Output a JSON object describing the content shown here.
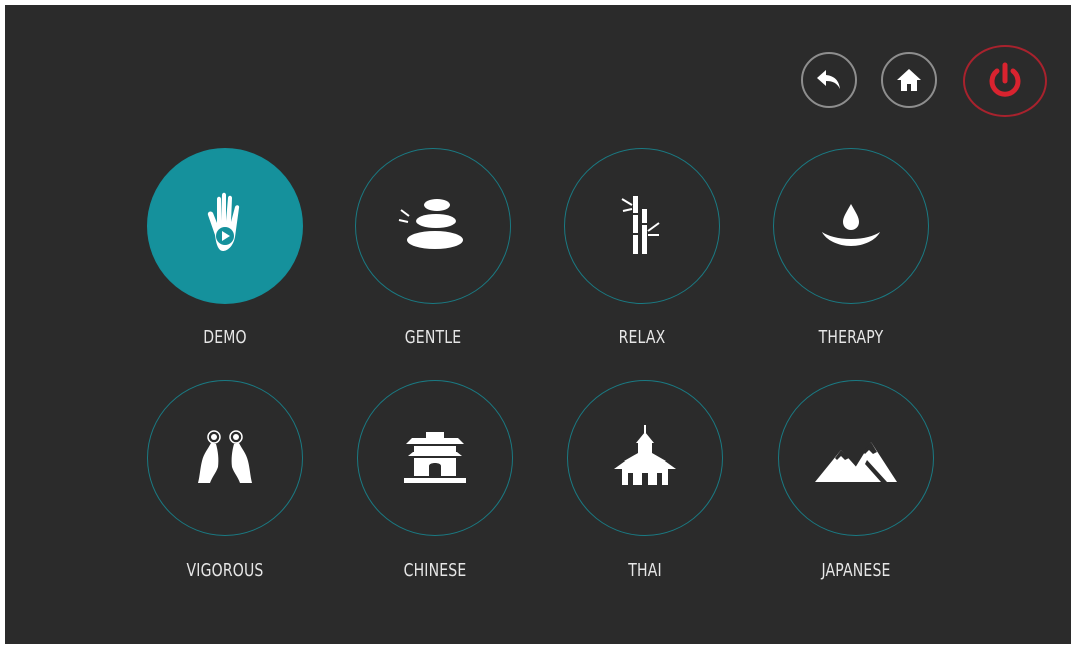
{
  "header": {
    "buttons": [
      {
        "name": "back",
        "icon": "back-arrow-icon"
      },
      {
        "name": "home",
        "icon": "home-icon"
      },
      {
        "name": "power",
        "icon": "power-icon",
        "color": "#d9232f"
      }
    ]
  },
  "colors": {
    "background": "#2b2b2b",
    "accent": "#15919c",
    "ring": "#1a7a83",
    "power": "#d9232f",
    "text": "#e6e6e6"
  },
  "modes": {
    "demo": {
      "label": "DEMO",
      "icon": "hand-play-icon",
      "active": true
    },
    "gentle": {
      "label": "GENTLE",
      "icon": "stacked-stones-icon"
    },
    "relax": {
      "label": "RELAX",
      "icon": "bamboo-icon"
    },
    "therapy": {
      "label": "THERAPY",
      "icon": "water-drop-icon"
    },
    "vigorous": {
      "label": "VIGOROUS",
      "icon": "pressing-hands-icon"
    },
    "chinese": {
      "label": "CHINESE",
      "icon": "chinese-gate-icon"
    },
    "thai": {
      "label": "THAI",
      "icon": "thai-temple-icon"
    },
    "japanese": {
      "label": "JAPANESE",
      "icon": "mountains-icon"
    }
  }
}
